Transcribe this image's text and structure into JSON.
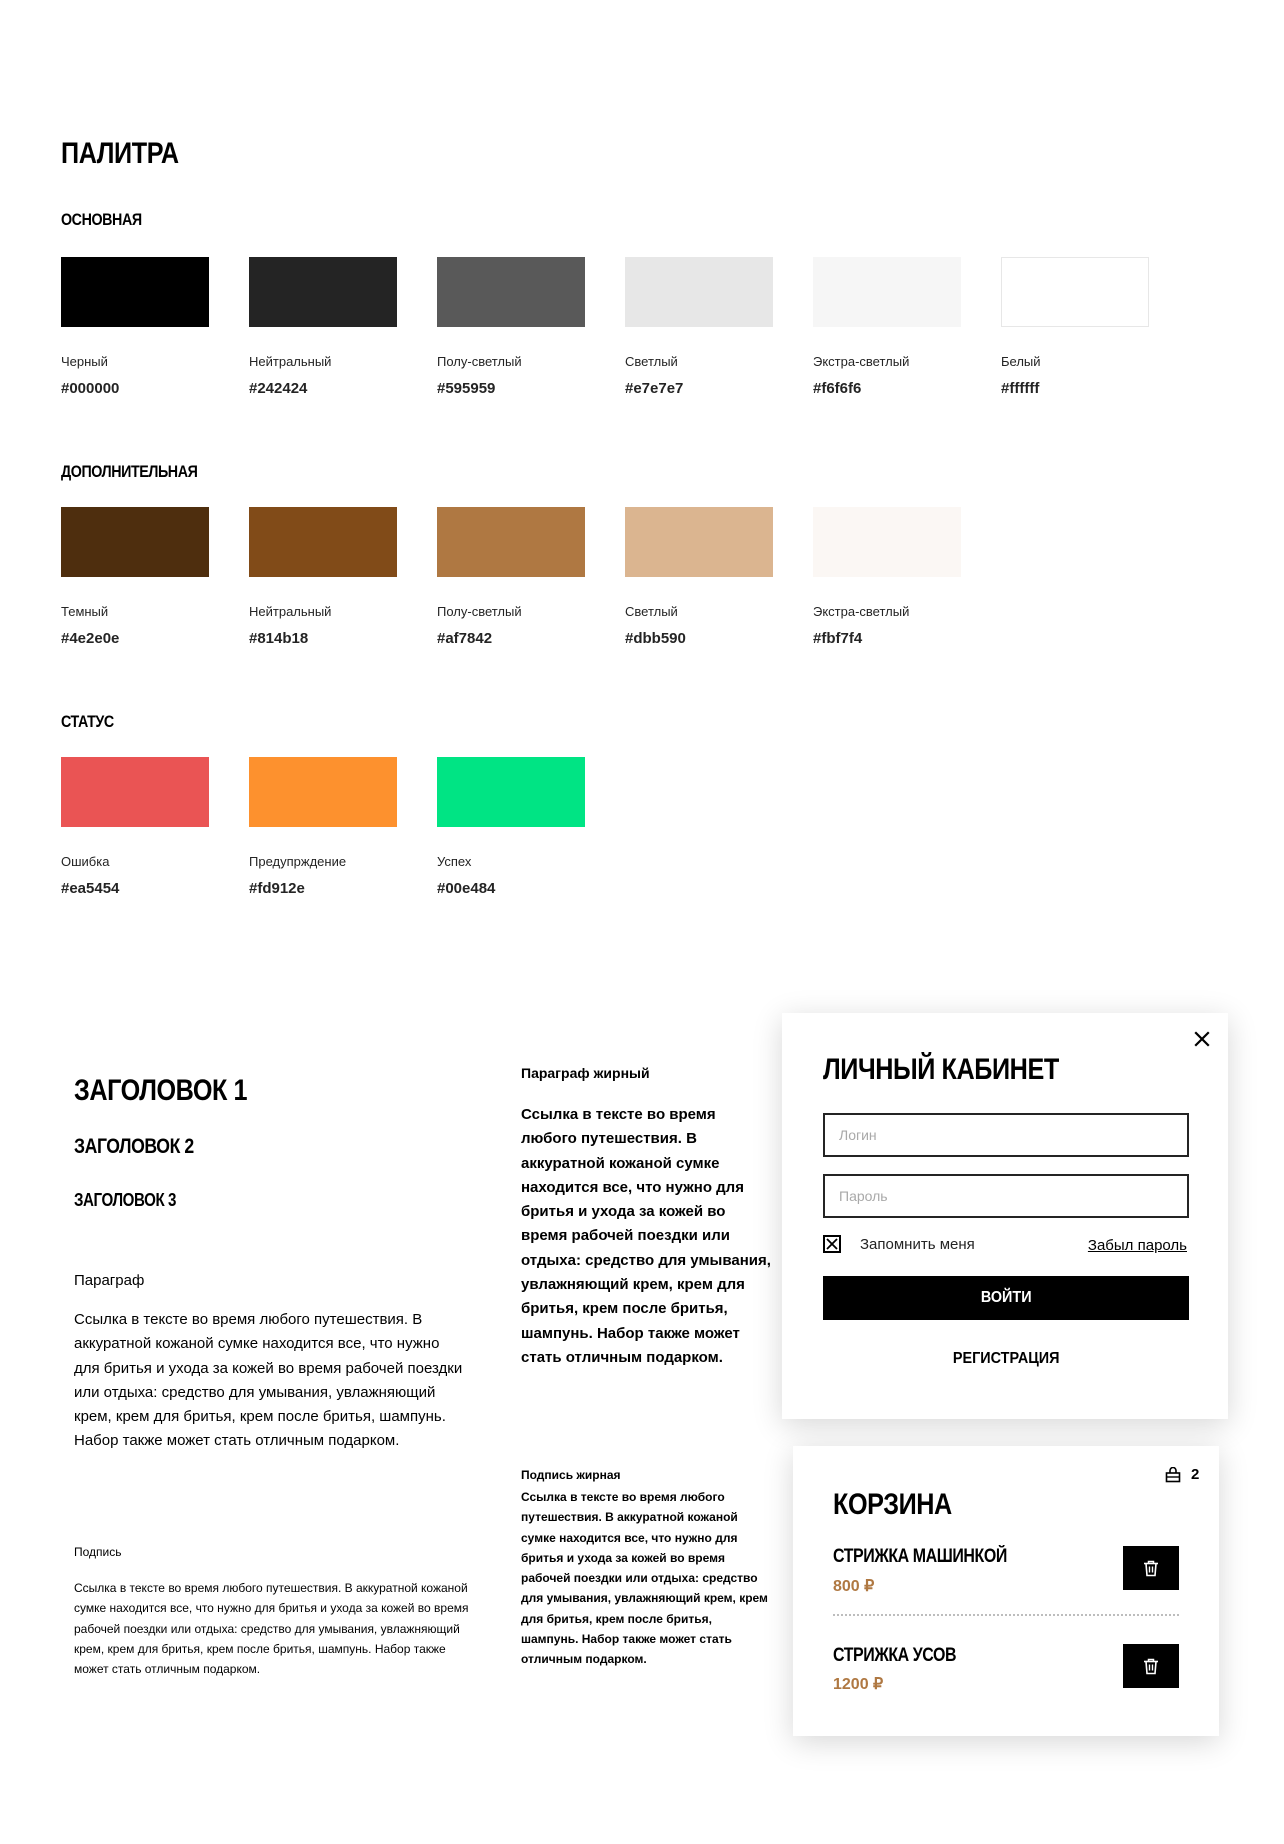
{
  "palette": {
    "title": "Палитра",
    "groups": [
      {
        "title": "Основная",
        "colors": [
          {
            "name": "Черный",
            "hex": "#000000"
          },
          {
            "name": "Нейтральный",
            "hex": "#242424"
          },
          {
            "name": "Полу-светлый",
            "hex": "#595959"
          },
          {
            "name": "Светлый",
            "hex": "#e7e7e7"
          },
          {
            "name": "Экстра-светлый",
            "hex": "#f6f6f6"
          },
          {
            "name": "Белый",
            "hex": "#ffffff"
          }
        ]
      },
      {
        "title": "Дополнительная",
        "colors": [
          {
            "name": "Темный",
            "hex": "#4e2e0e"
          },
          {
            "name": "Нейтральный",
            "hex": "#814b18"
          },
          {
            "name": "Полу-светлый",
            "hex": "#af7842"
          },
          {
            "name": "Светлый",
            "hex": "#dbb590"
          },
          {
            "name": "Экстра-светлый",
            "hex": "#fbf7f4"
          }
        ]
      },
      {
        "title": "Статус",
        "colors": [
          {
            "name": "Ошибка",
            "hex": "#ea5454"
          },
          {
            "name": "Предупрждение",
            "hex": "#fd912e"
          },
          {
            "name": "Успех",
            "hex": "#00e484"
          }
        ]
      }
    ]
  },
  "typography": {
    "h1": "Заголовок 1",
    "h2": "Заголовок 2",
    "h3": "Заголовок 3",
    "paragraph_label": "Параграф",
    "paragraph_text": "Ссылка в тексте во время любого путешествия. В аккуратной кожаной сумке находится все, что нужно для бритья и ухода за кожей во время рабочей поездки или отдыха: средство для умывания, увлажняющий крем, крем для бритья, крем после бритья, шампунь. Набор также может стать отличным подарком.",
    "caption_label": "Подпись",
    "caption_text": "Ссылка в тексте во время любого путешествия. В аккуратной кожаной сумке находится все, что нужно для бритья и ухода за кожей во время рабочей поездки или отдыха: средство для умывания, увлажняющий крем, крем для бритья, крем после бритья, шампунь. Набор также может стать отличным подарком.",
    "bold_paragraph_label": "Параграф жирный",
    "bold_paragraph_text": "Ссылка в тексте во время любого путешествия. В аккуратной кожаной сумке находится все, что нужно для бритья и ухода за кожей во время рабочей поездки или отдыха: средство для умывания, увлажняющий крем, крем для бритья, крем после бритья, шампунь. Набор также может стать отличным подарком.",
    "bold_caption_label": "Подпись жирная",
    "bold_caption_text": "Ссылка в тексте во время любого путешествия. В аккуратной кожаной сумке находится все, что нужно для бритья и ухода за кожей во время рабочей поездки или отдыха: средство для умывания, увлажняющий крем, крем для бритья, крем после бритья, шампунь. Набор также может стать отличным подарком."
  },
  "login": {
    "title": "Личный кабинет",
    "login_placeholder": "Логин",
    "password_placeholder": "Пароль",
    "remember_label": "Запомнить меня",
    "remember_checked": true,
    "forgot_label": "Забыл пароль",
    "submit_label": "Войти",
    "register_label": "Регистрация",
    "close_icon": "close-icon"
  },
  "cart": {
    "title": "Корзина",
    "count": "2",
    "count_icon": "basket-icon",
    "items": [
      {
        "name": "Стрижка машинкой",
        "price": "800 ₽"
      },
      {
        "name": "Стрижка усов",
        "price": "1200 ₽"
      }
    ],
    "delete_icon": "trash-icon"
  },
  "colors": {
    "accent": "#af7842",
    "text": "#000000",
    "border": "#242424"
  }
}
